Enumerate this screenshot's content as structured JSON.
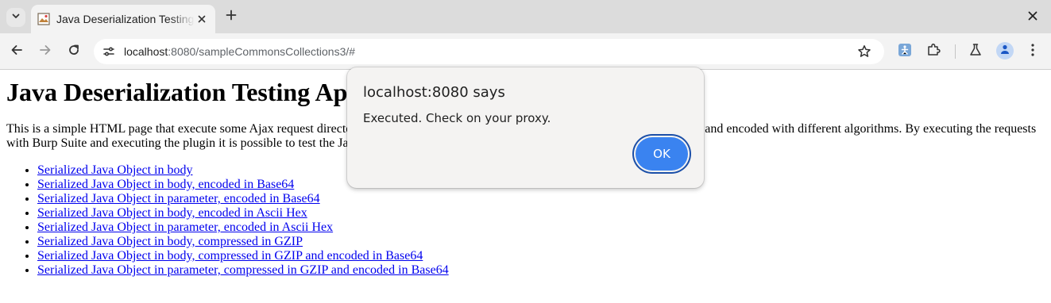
{
  "browser": {
    "tab": {
      "title": "Java Deserialization Testing Application"
    },
    "url": {
      "host": "localhost",
      "path": ":8080/sampleCommonsCollections3/#"
    },
    "accent": "#3a83f0"
  },
  "page": {
    "heading": "Java Deserialization Testing Ap",
    "intro": "This is a simple HTML page that execute some Ajax request directed to a Java application that deserializes objects sent in different ways and encoded with different algorithms. By executing the requests with Burp Suite and executing the plugin it is possible to test the Java Deserialization with all the different algorithms and methods.",
    "links": [
      "Serialized Java Object in body",
      "Serialized Java Object in body, encoded in Base64",
      "Serialized Java Object in parameter, encoded in Base64",
      "Serialized Java Object in body, encoded in Ascii Hex",
      "Serialized Java Object in parameter, encoded in Ascii Hex",
      "Serialized Java Object in body, compressed in GZIP",
      "Serialized Java Object in body, compressed in GZIP and encoded in Base64",
      "Serialized Java Object in parameter, compressed in GZIP and encoded in Base64"
    ]
  },
  "dialog": {
    "title": "localhost:8080 says",
    "message": "Executed. Check on your proxy.",
    "ok_label": "OK"
  },
  "icons": {
    "tab_search": "chevron-down-icon",
    "favicon": "image-favicon-icon",
    "tab_close": "close-icon",
    "new_tab": "plus-icon",
    "window_close": "close-icon",
    "back": "arrow-left-icon",
    "forward": "arrow-right-icon",
    "reload": "reload-icon",
    "site_info": "tune-icon",
    "bookmark": "star-icon",
    "extension1": "puzzle-accessibility-icon",
    "extensions": "puzzle-icon",
    "labs": "flask-icon",
    "profile": "avatar-icon",
    "menu": "kebab-menu-icon"
  }
}
